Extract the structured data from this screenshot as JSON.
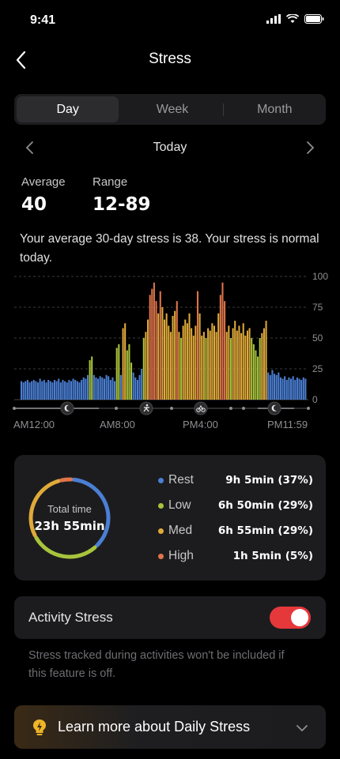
{
  "status_bar": {
    "time": "9:41"
  },
  "header": {
    "title": "Stress"
  },
  "tabs": [
    {
      "label": "Day",
      "active": true
    },
    {
      "label": "Week",
      "active": false
    },
    {
      "label": "Month",
      "active": false
    }
  ],
  "date_nav": {
    "label": "Today"
  },
  "stats": {
    "average_label": "Average",
    "average_value": "40",
    "range_label": "Range",
    "range_value": "12-89"
  },
  "description": "Your average 30-day stress is 38. Your stress is normal today.",
  "colors": {
    "rest": "#4a7fd4",
    "low": "#a8c43c",
    "med": "#e0aa3a",
    "high": "#e0744a",
    "accent": "#e5383b"
  },
  "chart_data": {
    "type": "bar",
    "y_ticks": [
      "100",
      "75",
      "50",
      "25",
      "0"
    ],
    "ylim": [
      0,
      100
    ],
    "x_labels": [
      "AM12:00",
      "AM8:00",
      "PM4:00",
      "PM11:59"
    ],
    "markers": [
      "sleep-icon",
      "run-icon",
      "bike-icon",
      "sleep-icon"
    ],
    "levels": [
      "rest",
      "low",
      "med",
      "high"
    ],
    "values": [
      15,
      14,
      15,
      16,
      14,
      15,
      16,
      15,
      14,
      17,
      15,
      16,
      14,
      16,
      15,
      14,
      16,
      15,
      17,
      14,
      16,
      15,
      14,
      16,
      15,
      17,
      16,
      15,
      14,
      16,
      18,
      17,
      20,
      32,
      35,
      20,
      18,
      17,
      19,
      18,
      17,
      20,
      19,
      16,
      18,
      15,
      42,
      45,
      20,
      58,
      62,
      40,
      45,
      30,
      22,
      18,
      16,
      20,
      25,
      50,
      55,
      65,
      85,
      90,
      95,
      80,
      70,
      88,
      75,
      65,
      70,
      60,
      55,
      68,
      72,
      80,
      55,
      50,
      60,
      65,
      62,
      70,
      58,
      52,
      60,
      88,
      70,
      52,
      55,
      50,
      58,
      56,
      62,
      60,
      55,
      70,
      85,
      95,
      80,
      55,
      60,
      50,
      58,
      64,
      56,
      60,
      54,
      62,
      52,
      56,
      58,
      50,
      45,
      40,
      35,
      50,
      54,
      58,
      64,
      22,
      20,
      24,
      21,
      20,
      22,
      18,
      17,
      19,
      16,
      18,
      17,
      19,
      16,
      18,
      17,
      16,
      18,
      17
    ]
  },
  "summary": {
    "total_label": "Total time",
    "total_value": "23h 55min",
    "rows": [
      {
        "name": "Rest",
        "value": "9h 5min (37%)",
        "color": "#4a7fd4"
      },
      {
        "name": "Low",
        "value": "6h 50min (29%)",
        "color": "#a8c43c"
      },
      {
        "name": "Med",
        "value": "6h 55min (29%)",
        "color": "#e0aa3a"
      },
      {
        "name": "High",
        "value": "1h 5min (5%)",
        "color": "#e0744a"
      }
    ],
    "ring_fractions": [
      0.37,
      0.29,
      0.29,
      0.05
    ]
  },
  "activity": {
    "label": "Activity Stress",
    "toggle_on": true,
    "note": "Stress tracked during activities won't be included if this feature is off."
  },
  "learn_more": {
    "label": "Learn more about Daily Stress"
  }
}
